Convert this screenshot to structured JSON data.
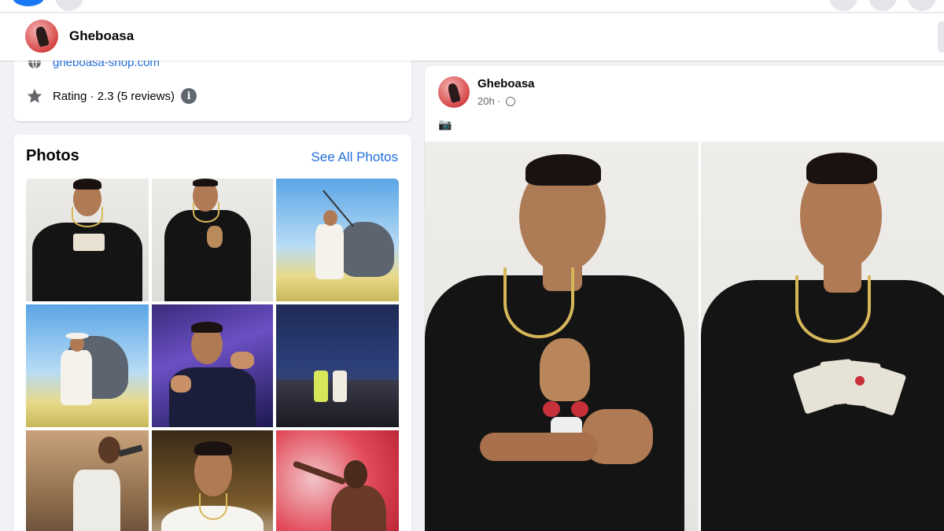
{
  "profile_header": {
    "name": "Gheboasa"
  },
  "intro": {
    "website": "gheboasa-shop.com",
    "rating": "Rating · 2.3 (5 reviews)",
    "info_glyph": "i"
  },
  "photos": {
    "title": "Photos",
    "see_all": "See All Photos",
    "items": [
      {
        "kind": "studio-black-tee-cards"
      },
      {
        "kind": "studio-black-tee-bear"
      },
      {
        "kind": "helicopter-white-outfit"
      },
      {
        "kind": "helicopter-hat"
      },
      {
        "kind": "party-pointing"
      },
      {
        "kind": "concert-stage"
      },
      {
        "kind": "crowd-performance"
      },
      {
        "kind": "smiling-portrait"
      },
      {
        "kind": "red-smoke-performance"
      }
    ]
  },
  "post": {
    "author": "Gheboasa",
    "time": "20h",
    "text": "📷",
    "icons": {
      "audience": "globe-icon"
    }
  },
  "colors": {
    "link": "#216fdb",
    "background": "#f0f2f5",
    "brand": "#1877f2"
  }
}
